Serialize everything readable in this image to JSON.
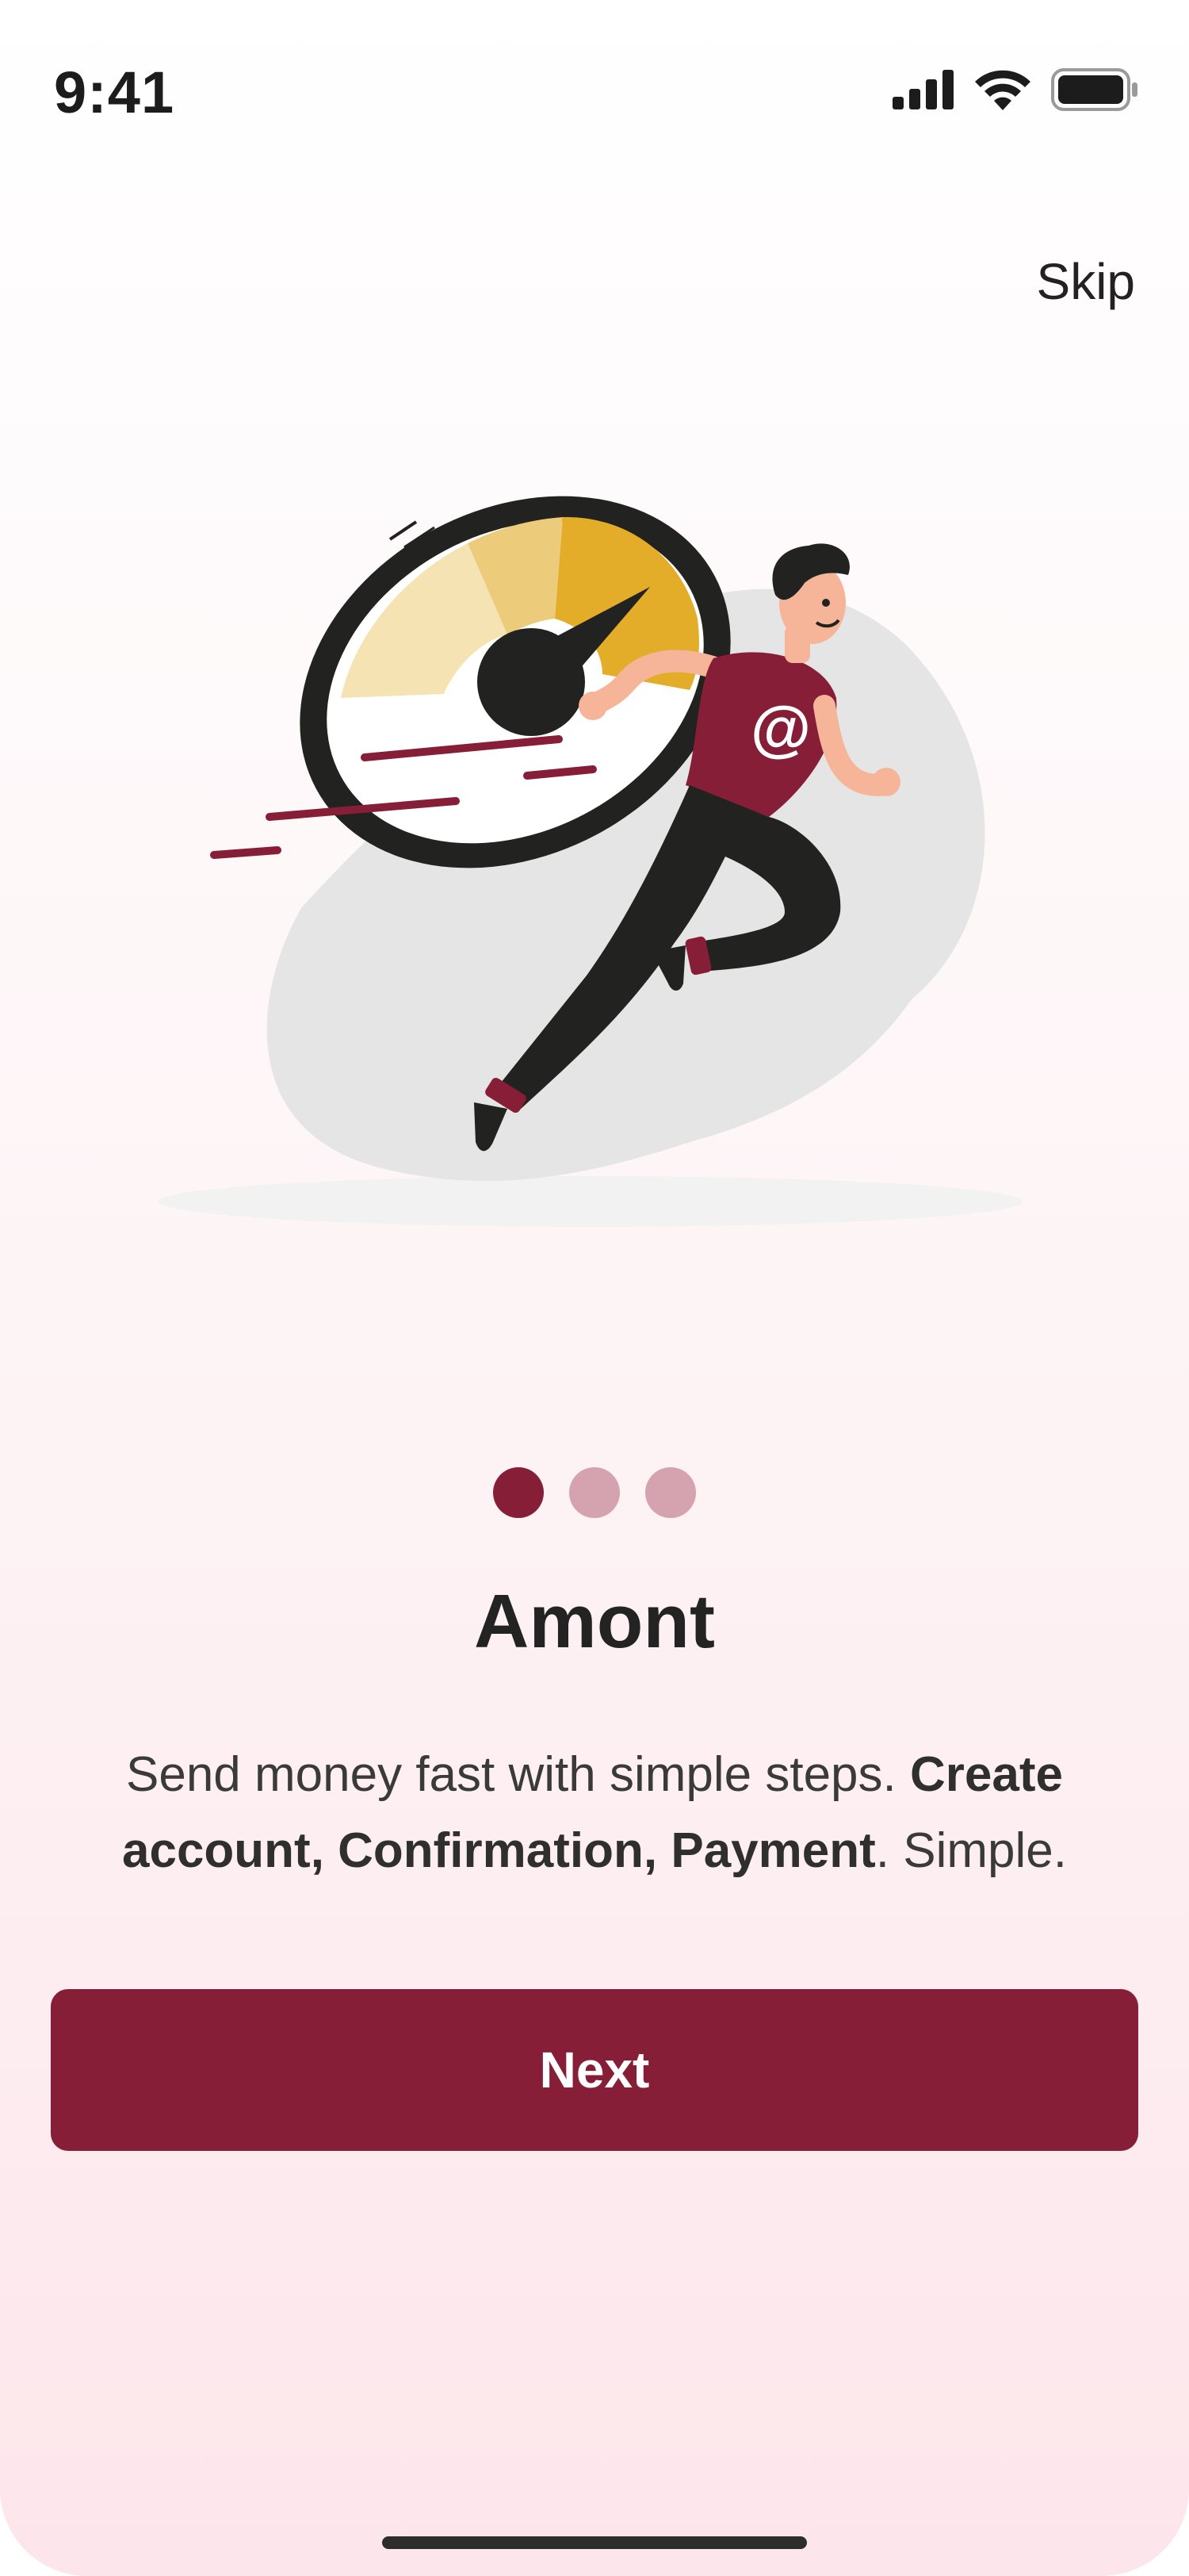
{
  "status_bar": {
    "time": "9:41",
    "icons": [
      "cellular-signal-icon",
      "wifi-icon",
      "battery-icon"
    ]
  },
  "header": {
    "skip_label": "Skip"
  },
  "illustration": {
    "icon": "running-man-speedometer-illustration",
    "shirt_symbol": "@"
  },
  "pagination": {
    "total": 3,
    "active_index": 0,
    "active_color": "#861e37",
    "inactive_color": "#d4a3af"
  },
  "onboarding": {
    "title": "Amont",
    "description_parts": [
      {
        "text": "Send money fast with simple steps. ",
        "bold": false
      },
      {
        "text": "Create account, Confirmation, Payment",
        "bold": true
      },
      {
        "text": ". Simple.",
        "bold": false
      }
    ]
  },
  "actions": {
    "next_label": "Next"
  },
  "colors": {
    "brand": "#861e37",
    "accent_yellow": "#e6b02a",
    "background_bottom": "#fde6eb"
  }
}
